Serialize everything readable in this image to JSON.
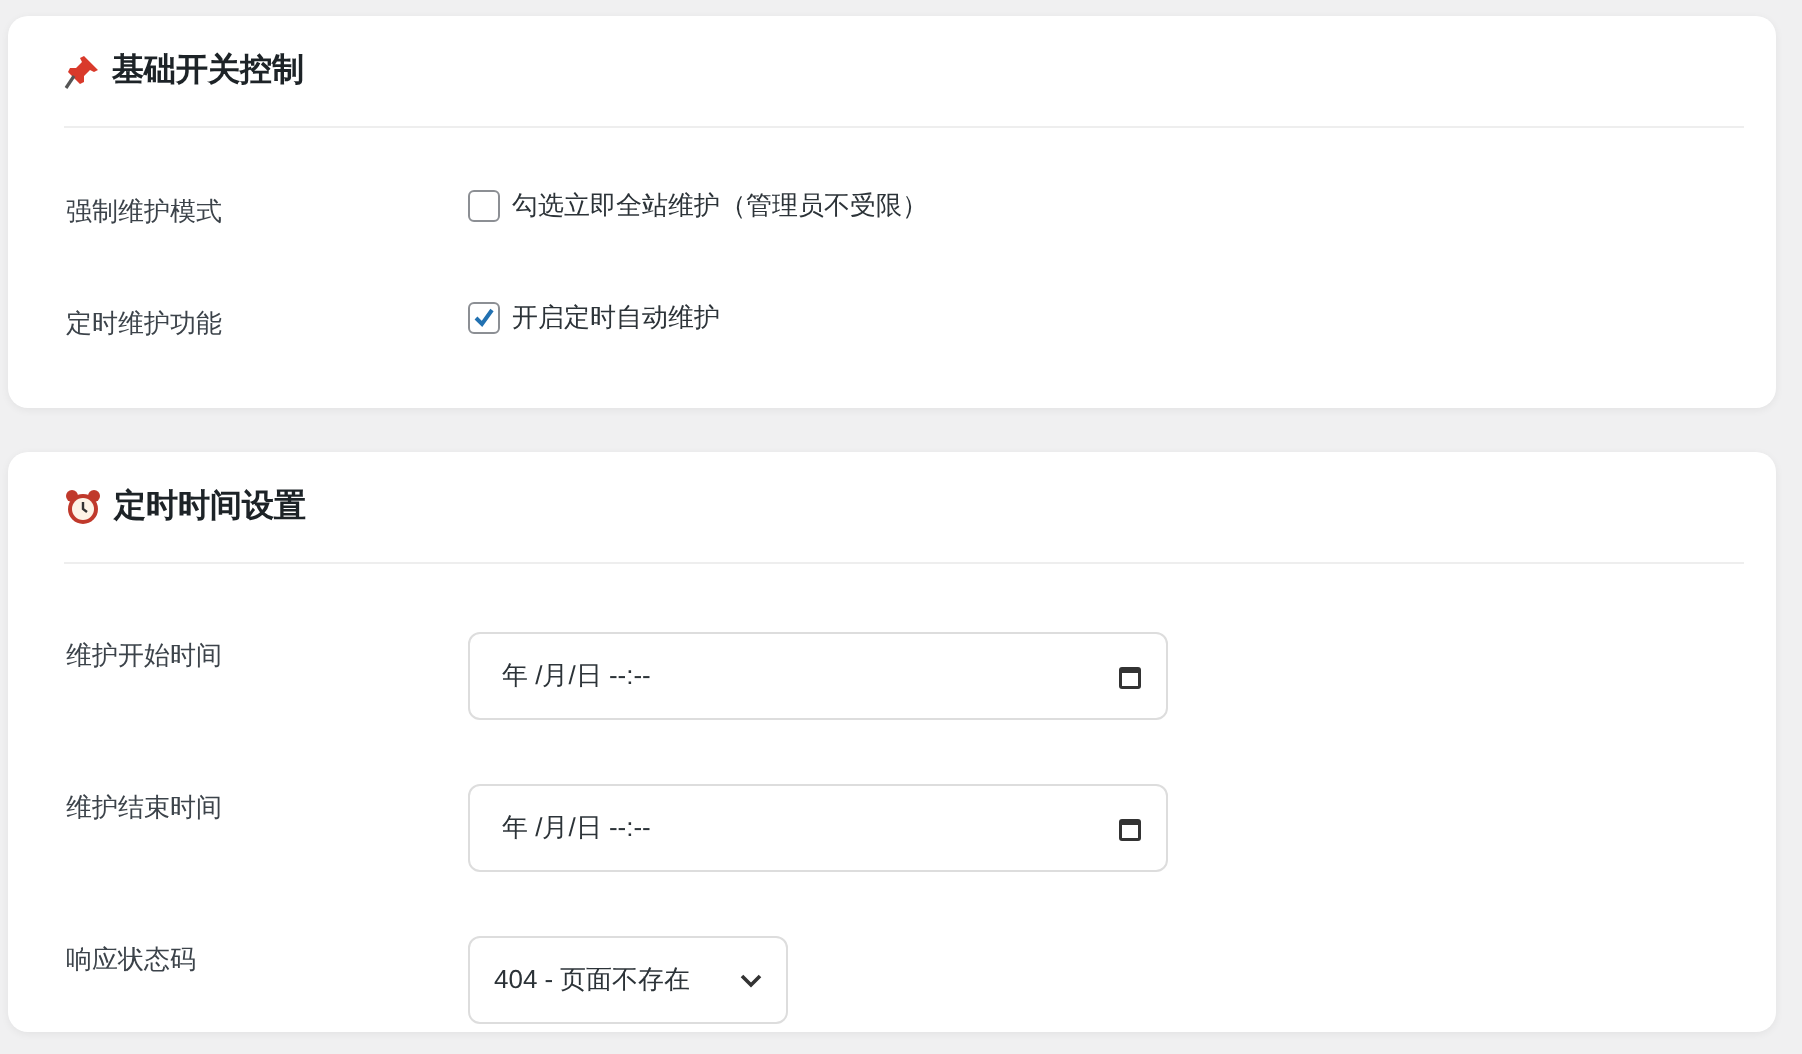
{
  "sections": [
    {
      "title": "基础开关控制",
      "rows": [
        {
          "kind": "checkbox",
          "label": "强制维护模式",
          "text": "勾选立即全站维护（管理员不受限）",
          "checked": false
        },
        {
          "kind": "checkbox",
          "label": "定时维护功能",
          "text": "开启定时自动维护",
          "checked": true
        }
      ]
    },
    {
      "title": "定时时间设置",
      "rows": [
        {
          "kind": "datetime",
          "label": "维护开始时间",
          "value": "年 /月/日 --:--"
        },
        {
          "kind": "datetime",
          "label": "维护结束时间",
          "value": "年 /月/日 --:--"
        },
        {
          "kind": "select",
          "label": "响应状态码",
          "value": "404 - 页面不存在"
        }
      ]
    }
  ]
}
